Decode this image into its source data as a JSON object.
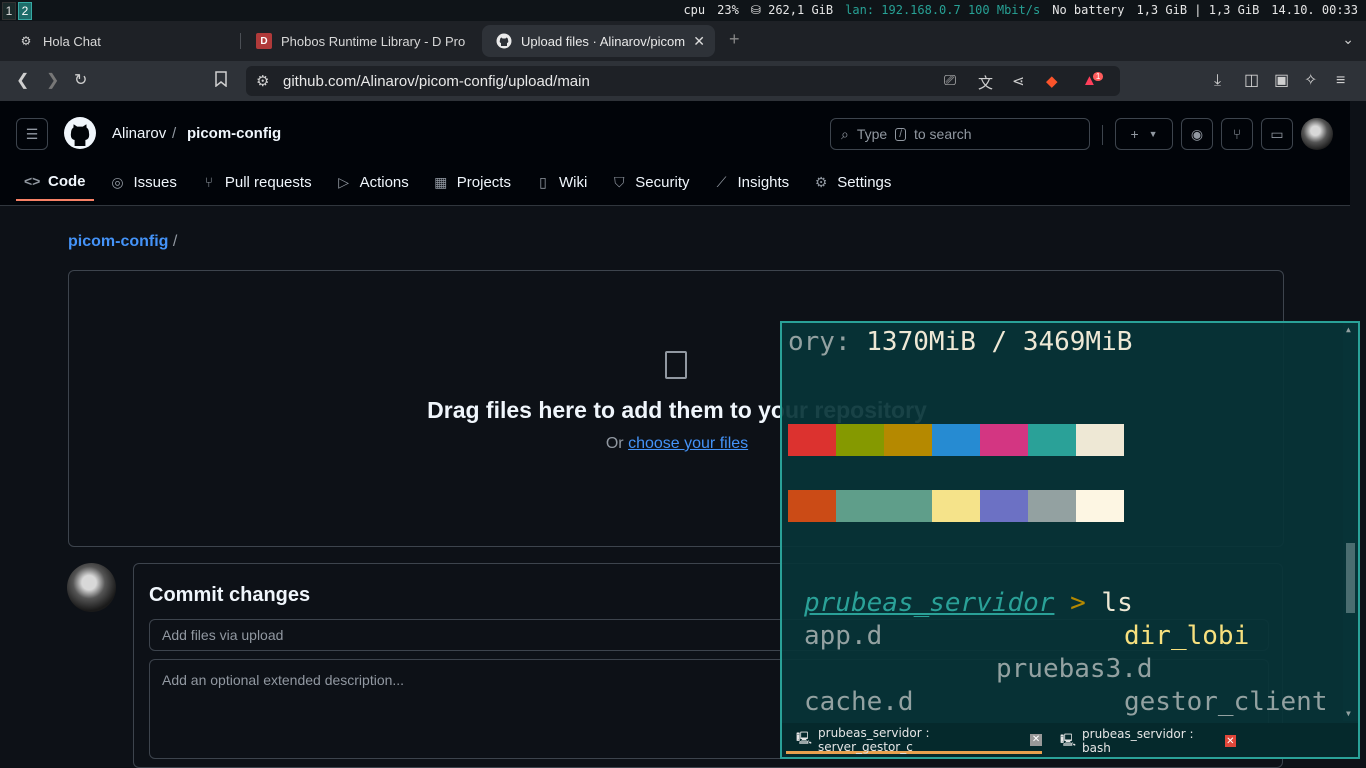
{
  "system_bar": {
    "workspaces": [
      "1",
      "2"
    ],
    "cpu_label": "cpu",
    "cpu_value": "23%",
    "disk": "262,1 GiB",
    "lan": "lan: 192.168.0.7 100 Mbit/s",
    "battery": "No battery",
    "memory": "1,3 GiB | 1,3 GiB",
    "datetime": "14.10. 00:33"
  },
  "browser": {
    "tabs": [
      {
        "title": "Hola Chat",
        "active": false
      },
      {
        "title": "Phobos Runtime Library - D Pro",
        "active": false
      },
      {
        "title": "Upload files · Alinarov/picom",
        "active": true
      }
    ],
    "url": "github.com/Alinarov/picom-config/upload/main",
    "brave_badge": "1"
  },
  "github": {
    "owner": "Alinarov",
    "separator": "/",
    "repo": "picom-config",
    "search_placeholder_pre": "Type",
    "search_key": "/",
    "search_placeholder_post": "to search",
    "nav": [
      "Code",
      "Issues",
      "Pull requests",
      "Actions",
      "Projects",
      "Wiki",
      "Security",
      "Insights",
      "Settings"
    ],
    "breadcrumb_repo": "picom-config",
    "breadcrumb_sep": "/",
    "drop_title": "Drag files here to add them to your repository",
    "drop_or": "Or",
    "drop_link": "choose your files",
    "commit_title": "Commit changes",
    "summary_placeholder": "Add files via upload",
    "description_placeholder": "Add an optional extended description..."
  },
  "terminal": {
    "memory_prefix": "ory:",
    "memory_value": "1370MiB / 3469MiB",
    "palette_row1": [
      "#dc322f",
      "#859900",
      "#b58900",
      "#268bd2",
      "#d33682",
      "#2aa198",
      "#eee8d5"
    ],
    "palette_row2": [
      "#cb4b16",
      "#5f9e8a",
      "#5f9e8a",
      "#f5e38a",
      "#6c71c4",
      "#93a1a1",
      "#fdf6e3"
    ],
    "prompt_dir": "prubeas_servidor",
    "prompt_arrow": ">",
    "command": "ls",
    "files": {
      "app": "app.d",
      "dir_lobi": "dir_lobi",
      "pruebas3": "pruebas3.d",
      "cache": "cache.d",
      "gestor": "gestor_client"
    },
    "tabs": [
      {
        "label": "prubeas_servidor : server_gestor_c",
        "active": true
      },
      {
        "label": "prubeas_servidor : bash",
        "active": false
      }
    ]
  }
}
